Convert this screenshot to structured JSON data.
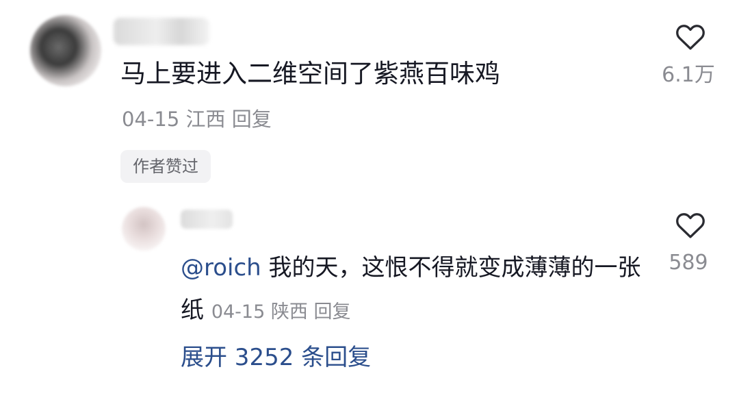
{
  "comment": {
    "text": "马上要进入二维空间了紫燕百味鸡",
    "date": "04-15",
    "location": "江西",
    "reply_label": "回复",
    "author_liked_badge": "作者赞过",
    "like_icon": "heart-outline-icon",
    "like_count": "6.1万"
  },
  "reply": {
    "mention": "@roich",
    "text": "我的天，这恨不得就变成薄薄的一张纸",
    "date": "04-15",
    "location": "陕西",
    "reply_label": "回复",
    "like_icon": "heart-outline-icon",
    "like_count": "589"
  },
  "expand_replies_label": "展开 3252 条回复",
  "colors": {
    "text": "#161823",
    "muted": "#8a8b91",
    "link": "#2b4e8c",
    "badge_bg": "#f2f2f4"
  }
}
